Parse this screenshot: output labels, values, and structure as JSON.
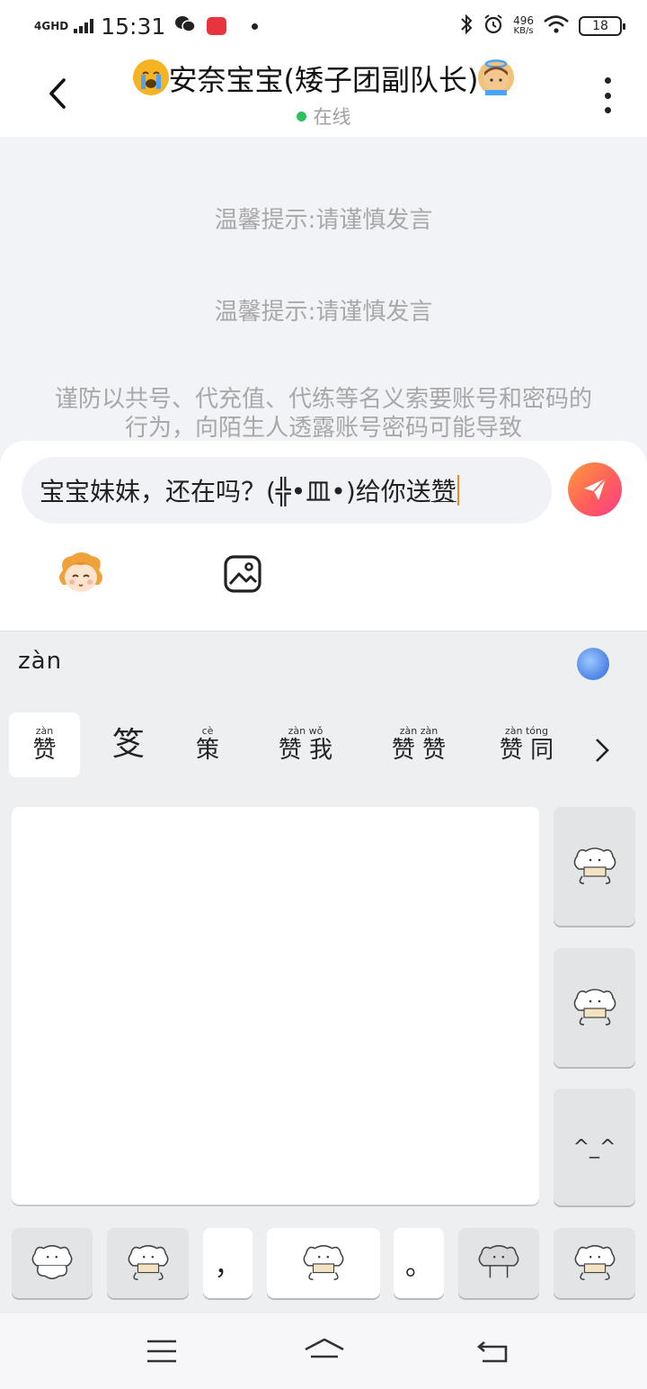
{
  "status_bar": {
    "network": "4GHD",
    "time": "15:31",
    "speed_value": "496",
    "speed_unit": "KB/s",
    "battery": "18"
  },
  "header": {
    "title": "安奈宝宝(矮子团副队长)",
    "status": "在线",
    "online_color": "#2ec05e"
  },
  "chat": {
    "notices": [
      "温馨提示:请谨慎发言",
      "温馨提示:请谨慎发言"
    ],
    "warning": "谨防以共号、代充值、代练等名义索要账号和密码的行为，向陌生人透露账号密码可能导致"
  },
  "input": {
    "text": "宝宝妹妹，还在吗？(╬•皿•)给你送",
    "composing": "赞",
    "send_color": "#ff5a5f"
  },
  "ime": {
    "pinyin": "zàn",
    "candidates": [
      {
        "py": "zàn",
        "hz": "赞"
      },
      {
        "py": "",
        "hz": "笅"
      },
      {
        "py": "cè",
        "hz": "策"
      },
      {
        "py": "zàn  wǒ",
        "hz": "赞 我"
      },
      {
        "py": "zàn  zàn",
        "hz": "赞 赞"
      },
      {
        "py": "zàn  tóng",
        "hz": "赞 同"
      }
    ],
    "side_keys": [
      "sticker",
      "sticker",
      "^_^"
    ],
    "bottom_keys": [
      "sticker",
      "sticker",
      "，",
      "sticker",
      "。",
      "sticker",
      "sticker"
    ],
    "face_text": "^_^"
  },
  "icons": {
    "back": "back-arrow-icon",
    "more": "more-dots-icon",
    "send": "paper-plane-icon",
    "emoji": "anime-face-icon",
    "image": "image-icon",
    "menu": "menu-icon",
    "home": "home-icon",
    "return": "return-icon"
  }
}
